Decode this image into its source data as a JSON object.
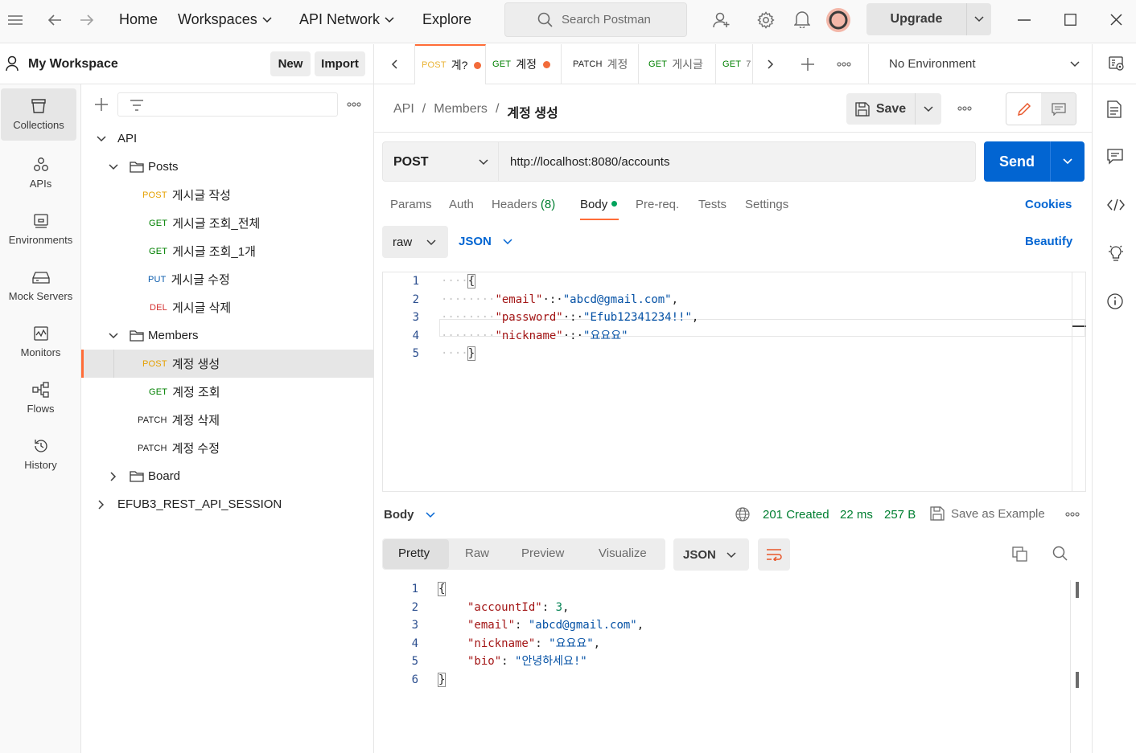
{
  "topbar": {
    "nav": {
      "home": "Home",
      "workspaces": "Workspaces",
      "api_network": "API Network",
      "explore": "Explore"
    },
    "search_placeholder": "Search Postman",
    "upgrade": "Upgrade"
  },
  "workspace": {
    "name": "My Workspace",
    "new_button": "New",
    "import_button": "Import"
  },
  "rail": [
    "Collections",
    "APIs",
    "Environments",
    "Mock Servers",
    "Monitors",
    "Flows",
    "History"
  ],
  "tree": {
    "api": "API",
    "posts_folder": "Posts",
    "posts": [
      {
        "method": "POST",
        "name": "게시글 작성"
      },
      {
        "method": "GET",
        "name": "게시글 조회_전체"
      },
      {
        "method": "GET",
        "name": "게시글 조회_1개"
      },
      {
        "method": "PUT",
        "name": "게시글 수정"
      },
      {
        "method": "DEL",
        "name": "게시글 삭제"
      }
    ],
    "members_folder": "Members",
    "members": [
      {
        "method": "POST",
        "name": "계정 생성"
      },
      {
        "method": "GET",
        "name": "계정 조회"
      },
      {
        "method": "PATCH",
        "name": "계정 삭제"
      },
      {
        "method": "PATCH",
        "name": "계정 수정"
      }
    ],
    "board_folder": "Board",
    "session_collection": "EFUB3_REST_API_SESSION"
  },
  "tabs": [
    {
      "method": "POST",
      "name": "계?"
    },
    {
      "method": "GET",
      "name": "계정"
    },
    {
      "method": "PATCH",
      "name": "계정"
    },
    {
      "method": "GET",
      "name": "게시글"
    },
    {
      "method": "GET",
      "name": "7"
    }
  ],
  "environment": "No Environment",
  "breadcrumb": {
    "root": "API",
    "folder": "Members",
    "current": "계정 생성",
    "sep": "/"
  },
  "save_label": "Save",
  "request": {
    "method": "POST",
    "url": "http://localhost:8080/accounts",
    "send": "Send",
    "tabs": {
      "params": "Params",
      "auth": "Auth",
      "headers": "Headers",
      "headers_count": "(8)",
      "body": "Body",
      "prereq": "Pre-req.",
      "tests": "Tests",
      "settings": "Settings"
    },
    "cookies": "Cookies",
    "body_mode": "raw",
    "body_lang": "JSON",
    "beautify": "Beautify",
    "line_numbers": [
      "1",
      "2",
      "3",
      "4",
      "5"
    ],
    "body": {
      "open": "{",
      "close": "}",
      "email_key": "\"email\"",
      "email_val": "\"abcd@gmail.com\"",
      "password_key": "\"password\"",
      "password_val": "\"Efub12341234!!\"",
      "nickname_key": "\"nickname\"",
      "nickname_val": "\"요요요\""
    }
  },
  "response": {
    "label": "Body",
    "status": "201 Created",
    "time": "22 ms",
    "size": "257 B",
    "save_example": "Save as Example",
    "tabs": {
      "pretty": "Pretty",
      "raw": "Raw",
      "preview": "Preview",
      "visualize": "Visualize"
    },
    "format": "JSON",
    "line_numbers": [
      "1",
      "2",
      "3",
      "4",
      "5",
      "6"
    ],
    "body": {
      "open": "{",
      "close": "}",
      "accountId_key": "\"accountId\"",
      "accountId_val": "3",
      "email_key": "\"email\"",
      "email_val": "\"abcd@gmail.com\"",
      "nickname_key": "\"nickname\"",
      "nickname_val": "\"요요요\"",
      "bio_key": "\"bio\"",
      "bio_val": "\"안녕하세요!\""
    }
  },
  "colors": {
    "accent": "#ff6c37",
    "send": "#0265d2",
    "status": "#007f31"
  }
}
